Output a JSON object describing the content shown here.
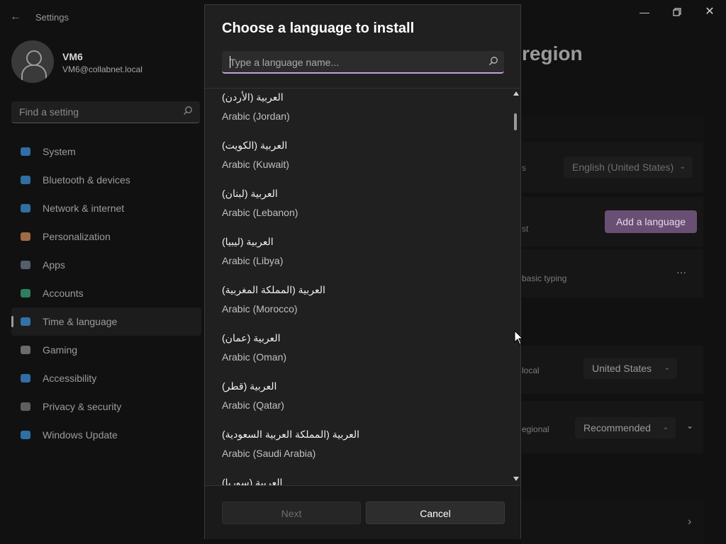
{
  "window": {
    "app_title": "Settings",
    "user_name": "VM6",
    "user_email": "VM6@collabnet.local",
    "search_placeholder": "Find a setting",
    "page_title_fragment": "region"
  },
  "nav": [
    {
      "label": "System",
      "icon": "monitor-icon",
      "color": "#3a8fd6"
    },
    {
      "label": "Bluetooth & devices",
      "icon": "bluetooth-icon",
      "color": "#3a8fd6"
    },
    {
      "label": "Network & internet",
      "icon": "wifi-icon",
      "color": "#3a8fd6"
    },
    {
      "label": "Personalization",
      "icon": "brush-icon",
      "color": "#d08a55"
    },
    {
      "label": "Apps",
      "icon": "apps-icon",
      "color": "#6a7a8a"
    },
    {
      "label": "Accounts",
      "icon": "person-icon",
      "color": "#3aa37a"
    },
    {
      "label": "Time & language",
      "icon": "globe-clock-icon",
      "color": "#3a8fd6",
      "active": true
    },
    {
      "label": "Gaming",
      "icon": "gamepad-icon",
      "color": "#8a8a8a"
    },
    {
      "label": "Accessibility",
      "icon": "accessibility-icon",
      "color": "#3a8fd6"
    },
    {
      "label": "Privacy & security",
      "icon": "shield-icon",
      "color": "#7a7a7a"
    },
    {
      "label": "Windows Update",
      "icon": "update-icon",
      "color": "#3a8fd6"
    }
  ],
  "background": {
    "display_language_value": "English (United States)",
    "label_s": "s",
    "label_st": "st",
    "add_language_label": "Add a language",
    "basic_typing_label": "basic typing",
    "more_label": "···",
    "local_label": "local",
    "country_value": "United States",
    "regional_label": "egional",
    "format_value": "Recommended"
  },
  "dialog": {
    "title": "Choose a language to install",
    "search_placeholder": "Type a language name...",
    "languages": [
      {
        "native": "العربية (الأردن)",
        "english": "Arabic (Jordan)"
      },
      {
        "native": "العربية (الكويت)",
        "english": "Arabic (Kuwait)"
      },
      {
        "native": "العربية (لبنان)",
        "english": "Arabic (Lebanon)"
      },
      {
        "native": "العربية (ليبيا)",
        "english": "Arabic (Libya)"
      },
      {
        "native": "العربية (المملكة المغربية)",
        "english": "Arabic (Morocco)"
      },
      {
        "native": "العربية (عمان)",
        "english": "Arabic (Oman)"
      },
      {
        "native": "العربية (قطر)",
        "english": "Arabic (Qatar)"
      },
      {
        "native": "العربية (المملكة العربية السعودية)",
        "english": "Arabic (Saudi Arabia)"
      },
      {
        "native": "العربية (سوريا)",
        "english": ""
      }
    ],
    "next_label": "Next",
    "cancel_label": "Cancel",
    "accent_color": "#c5a2d6"
  }
}
